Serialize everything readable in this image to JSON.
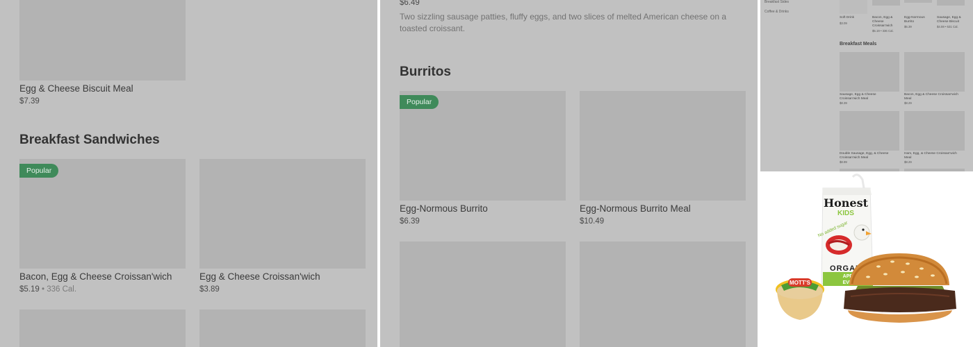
{
  "panel_a": {
    "top_item": {
      "name": "Egg & Cheese Biscuit Meal",
      "price": "$7.39"
    },
    "section_title": "Breakfast Sandwiches",
    "items": [
      {
        "name": "Bacon, Egg & Cheese Croissan'wich",
        "price": "$5.19",
        "calories": "• 336 Cal.",
        "badge": "Popular"
      },
      {
        "name": "Egg & Cheese Croissan'wich",
        "price": "$3.89"
      }
    ]
  },
  "panel_b": {
    "top_price": "$6.49",
    "top_description": "Two sizzling sausage patties, fluffy eggs, and two slices of melted American cheese on a toasted croissant.",
    "section_title": "Burritos",
    "items": [
      {
        "name": "Egg-Normous Burrito",
        "price": "$6.39",
        "badge": "Popular"
      },
      {
        "name": "Egg-Normous Burrito Meal",
        "price": "$10.49"
      }
    ]
  },
  "panel_c": {
    "nav": [
      "Breakfast Sides",
      "Coffee & Drinks"
    ],
    "top_row": [
      {
        "name": "Soft Drink",
        "price": "$3.09"
      },
      {
        "name": "Bacon, Egg & Cheese Croissan'wich",
        "price": "$5.19 • 336 Cal."
      },
      {
        "name": "Egg-Normous Burrito",
        "price": "$6.39"
      },
      {
        "name": "Sausage, Egg & Cheese Biscuit",
        "price": "$4.59 • 531 Cal."
      }
    ],
    "section_title": "Breakfast Meals",
    "meals": [
      {
        "name": "Sausage, Egg & Cheese Croissan'wich Meal",
        "price": "$8.39"
      },
      {
        "name": "Bacon, Egg & Cheese Croissan'wich Meal",
        "price": "$8.29"
      },
      {
        "name": "Double Sausage, Egg, & Cheese Croissan'wich Meal",
        "price": "$8.99"
      },
      {
        "name": "Ham, Egg, & Cheese Croissan'wich Meal",
        "price": "$8.29"
      }
    ]
  },
  "panel_d": {
    "juice_brand": "Honest",
    "juice_sub": "KIDS",
    "juice_claim": "No added sugar",
    "juice_organic": "ORGAN",
    "juice_flavor": "APPL",
    "juice_flavor2": "EVER",
    "applesauce_brand": "MOTT'S",
    "colors": {
      "bun": "#d28a3a",
      "patty": "#4a2a1c",
      "juice_green": "#8cc63f"
    }
  }
}
